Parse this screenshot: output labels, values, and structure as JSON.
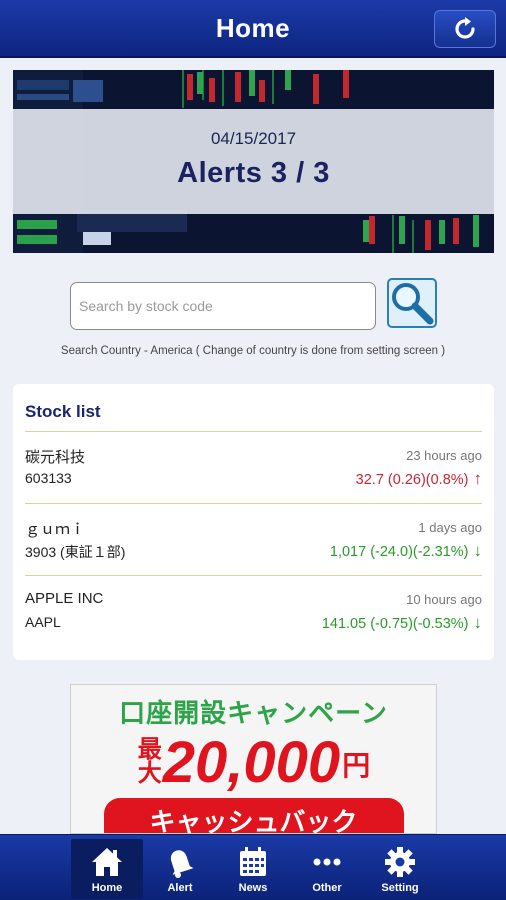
{
  "header": {
    "title": "Home",
    "refresh_icon": "refresh-icon"
  },
  "banner": {
    "date": "04/15/2017",
    "alerts": "Alerts  3 / 3"
  },
  "search": {
    "placeholder": "Search by stock code",
    "value": "",
    "note": "Search Country - America ( Change of country is done from setting screen )"
  },
  "stock_list": {
    "title": "Stock list",
    "items": [
      {
        "name": "碳元科技",
        "code": "603133",
        "time": "23 hours ago",
        "price": "32.7 (0.26)(0.8%)",
        "direction": "up",
        "arrow": "↑"
      },
      {
        "name": "ｇｕｍｉ",
        "code": "3903 (東証１部)",
        "time": "1 days ago",
        "price": "1,017 (-24.0)(-2.31%)",
        "direction": "down",
        "arrow": "↓"
      },
      {
        "name": "APPLE INC",
        "code": "AAPL",
        "time": "10 hours ago",
        "price": "141.05 (-0.75)(-0.53%)",
        "direction": "down",
        "arrow": "↓"
      }
    ]
  },
  "ad": {
    "line1": "口座開設キャンペーン",
    "max": "最大",
    "amount": "20,000",
    "yen": "円",
    "line3": "キャッシュバック"
  },
  "tabs": [
    {
      "label": "Home",
      "icon": "home-icon"
    },
    {
      "label": "Alert",
      "icon": "bell-icon"
    },
    {
      "label": "News",
      "icon": "calendar-icon"
    },
    {
      "label": "Other",
      "icon": "more-icon"
    },
    {
      "label": "Setting",
      "icon": "gear-icon"
    }
  ],
  "colors": {
    "header": "#1c3aa8",
    "up": "#c0283a",
    "down": "#2a9a2a",
    "accent": "#1a2470"
  }
}
